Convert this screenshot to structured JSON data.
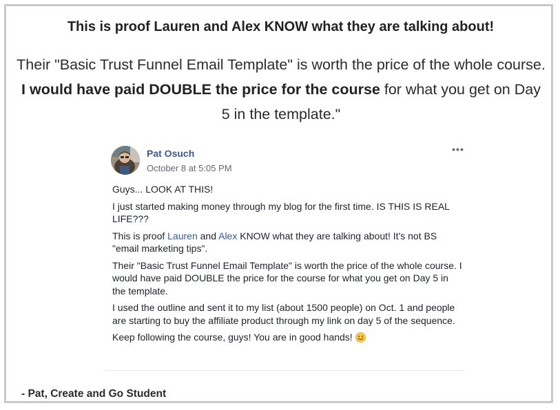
{
  "headline": "This is proof Lauren and Alex KNOW what they are talking about!",
  "quote": {
    "part1": "Their \"Basic Trust Funnel Email Template\" is worth the price of the whole course. ",
    "bold": "I would have paid DOUBLE the price for the course",
    "part2": " for what you get on Day 5 in the template.\""
  },
  "post": {
    "author": "Pat Osuch",
    "timestamp": "October 8 at 5:05 PM",
    "more_label": "•••",
    "p1": "Guys... LOOK AT THIS!",
    "p2": "I just started making money through my blog for the first time. IS THIS IS REAL LIFE???",
    "p3_a": "This is proof ",
    "p3_link1": "Lauren",
    "p3_b": " and ",
    "p3_link2": "Alex",
    "p3_c": " KNOW what they are talking about! It's not BS \"email marketing tips\".",
    "p4": "Their \"Basic Trust Funnel Email Template\" is worth the price of the whole course. I would have paid DOUBLE the price for the course for what you get on Day 5 in the template.",
    "p5": "I used the outline and sent it to my list (about 1500 people) on Oct. 1 and people are starting to buy the affiliate product through my link on day 5 of the sequence.",
    "p6": "Keep following the course, guys! You are in good hands! ",
    "emoji": "smiley-emoji"
  },
  "signature": "- Pat, Create and Go Student",
  "colors": {
    "frame_border": "#c9c9c9",
    "link": "#385898",
    "muted": "#606770",
    "text": "#1d2129"
  }
}
